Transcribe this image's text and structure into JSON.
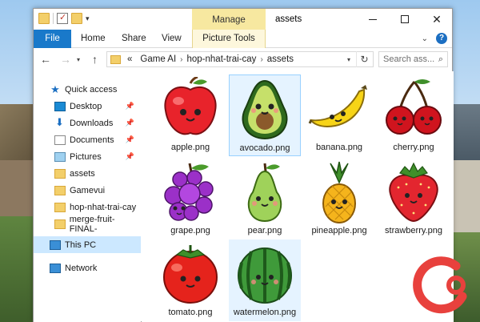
{
  "window": {
    "title": "assets",
    "manage_tab": "Manage",
    "controls": {
      "minimize": "minimize",
      "maximize": "maximize",
      "close": "✕"
    }
  },
  "ribbon": {
    "tabs": [
      "File",
      "Home",
      "Share",
      "View",
      "Picture Tools"
    ]
  },
  "address": {
    "prefix": "«",
    "path": [
      "Game AI",
      "hop-nhat-trai-cay",
      "assets"
    ],
    "separator": "›",
    "search_placeholder": "Search ass..."
  },
  "nav": {
    "quick_access": "Quick access",
    "items": [
      {
        "label": "Desktop",
        "icon": "desktop-icon",
        "pinned": true
      },
      {
        "label": "Downloads",
        "icon": "downloads-icon",
        "pinned": true
      },
      {
        "label": "Documents",
        "icon": "documents-icon",
        "pinned": true
      },
      {
        "label": "Pictures",
        "icon": "pictures-icon",
        "pinned": true
      },
      {
        "label": "assets",
        "icon": "folder-icon",
        "pinned": false
      },
      {
        "label": "Gamevui",
        "icon": "folder-icon",
        "pinned": false
      },
      {
        "label": "hop-nhat-trai-cay",
        "icon": "folder-icon",
        "pinned": false
      },
      {
        "label": "merge-fruit-FINAL-",
        "icon": "folder-icon",
        "pinned": false
      }
    ],
    "this_pc": "This PC",
    "network": "Network",
    "pin_glyph": "📌"
  },
  "files": [
    {
      "name": "apple.png",
      "fruit": "apple",
      "color": "#e8232b"
    },
    {
      "name": "avocado.png",
      "fruit": "avocado",
      "color": "#8cc63f",
      "selected": true
    },
    {
      "name": "banana.png",
      "fruit": "banana",
      "color": "#f7d417"
    },
    {
      "name": "cherry.png",
      "fruit": "cherry",
      "color": "#d0141e"
    },
    {
      "name": "grape.png",
      "fruit": "grape",
      "color": "#9b30c8"
    },
    {
      "name": "pear.png",
      "fruit": "pear",
      "color": "#9fd25a"
    },
    {
      "name": "pineapple.png",
      "fruit": "pineapple",
      "color": "#f5b41c"
    },
    {
      "name": "strawberry.png",
      "fruit": "strawberry",
      "color": "#e3262f"
    },
    {
      "name": "tomato.png",
      "fruit": "tomato",
      "color": "#e5231c"
    },
    {
      "name": "watermelon.png",
      "fruit": "watermelon",
      "color": "#3f9a3a",
      "hovered": true
    }
  ],
  "logo": {
    "color": "#e8413d",
    "icon": "brand-logo-icon"
  }
}
